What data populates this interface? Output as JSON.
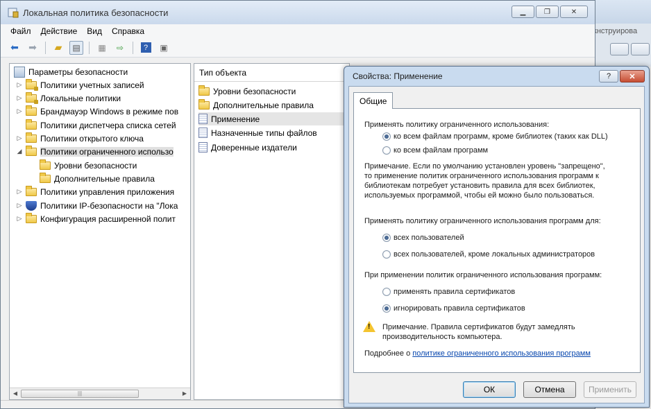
{
  "background_window": {
    "fragment_text": "кнструирова"
  },
  "main_window": {
    "title": "Локальная политика безопасности",
    "menu": [
      "Файл",
      "Действие",
      "Вид",
      "Справка"
    ],
    "tree": {
      "root": "Параметры безопасности",
      "items": [
        "Политики учетных записей",
        "Локальные политики",
        "Брандмауэр Windows в режиме пов",
        "Политики диспетчера списка сетей",
        "Политики открытого ключа",
        "Политики ограниченного использо",
        "Уровни безопасности",
        "Дополнительные правила",
        "Политики управления приложения",
        "Политики IP-безопасности на \"Лока",
        "Конфигурация расширенной полит"
      ]
    },
    "list": {
      "header": "Тип объекта",
      "items": [
        "Уровни безопасности",
        "Дополнительные правила",
        "Применение",
        "Назначенные типы файлов",
        "Доверенные издатели"
      ]
    }
  },
  "dialog": {
    "title": "Свойства: Применение",
    "help_label": "?",
    "tab": "Общие",
    "section1": {
      "label": "Применять политику ограниченного использования:",
      "options": [
        "ко всем файлам программ, кроме библиотек (таких как DLL)",
        "ко всем файлам программ"
      ],
      "selected": 0
    },
    "note1": [
      "Примечание. Если по умолчанию установлен уровень \"запрещено\",",
      "то применение политик ограниченного использования программ к",
      "библиотекам потребует установить правила для всех библиотек,",
      "используемых  программой, чтобы ей можно было пользоваться."
    ],
    "section2": {
      "label": "Применять политику ограниченного использования программ для:",
      "options": [
        "всех пользователей",
        "всех пользователей, кроме локальных администраторов"
      ],
      "selected": 0
    },
    "section3": {
      "label": "При применении политик ограниченного использования программ:",
      "options": [
        "применять правила сертификатов",
        "игнорировать правила сертификатов"
      ],
      "selected": 1
    },
    "warning": [
      "Примечание. Правила сертификатов будут замедлять",
      "производительность компьютера."
    ],
    "more_prefix": "Подробнее о ",
    "more_link": "политике ограниченного использования программ",
    "buttons": {
      "ok": "ОК",
      "cancel": "Отмена",
      "apply": "Применить"
    }
  }
}
